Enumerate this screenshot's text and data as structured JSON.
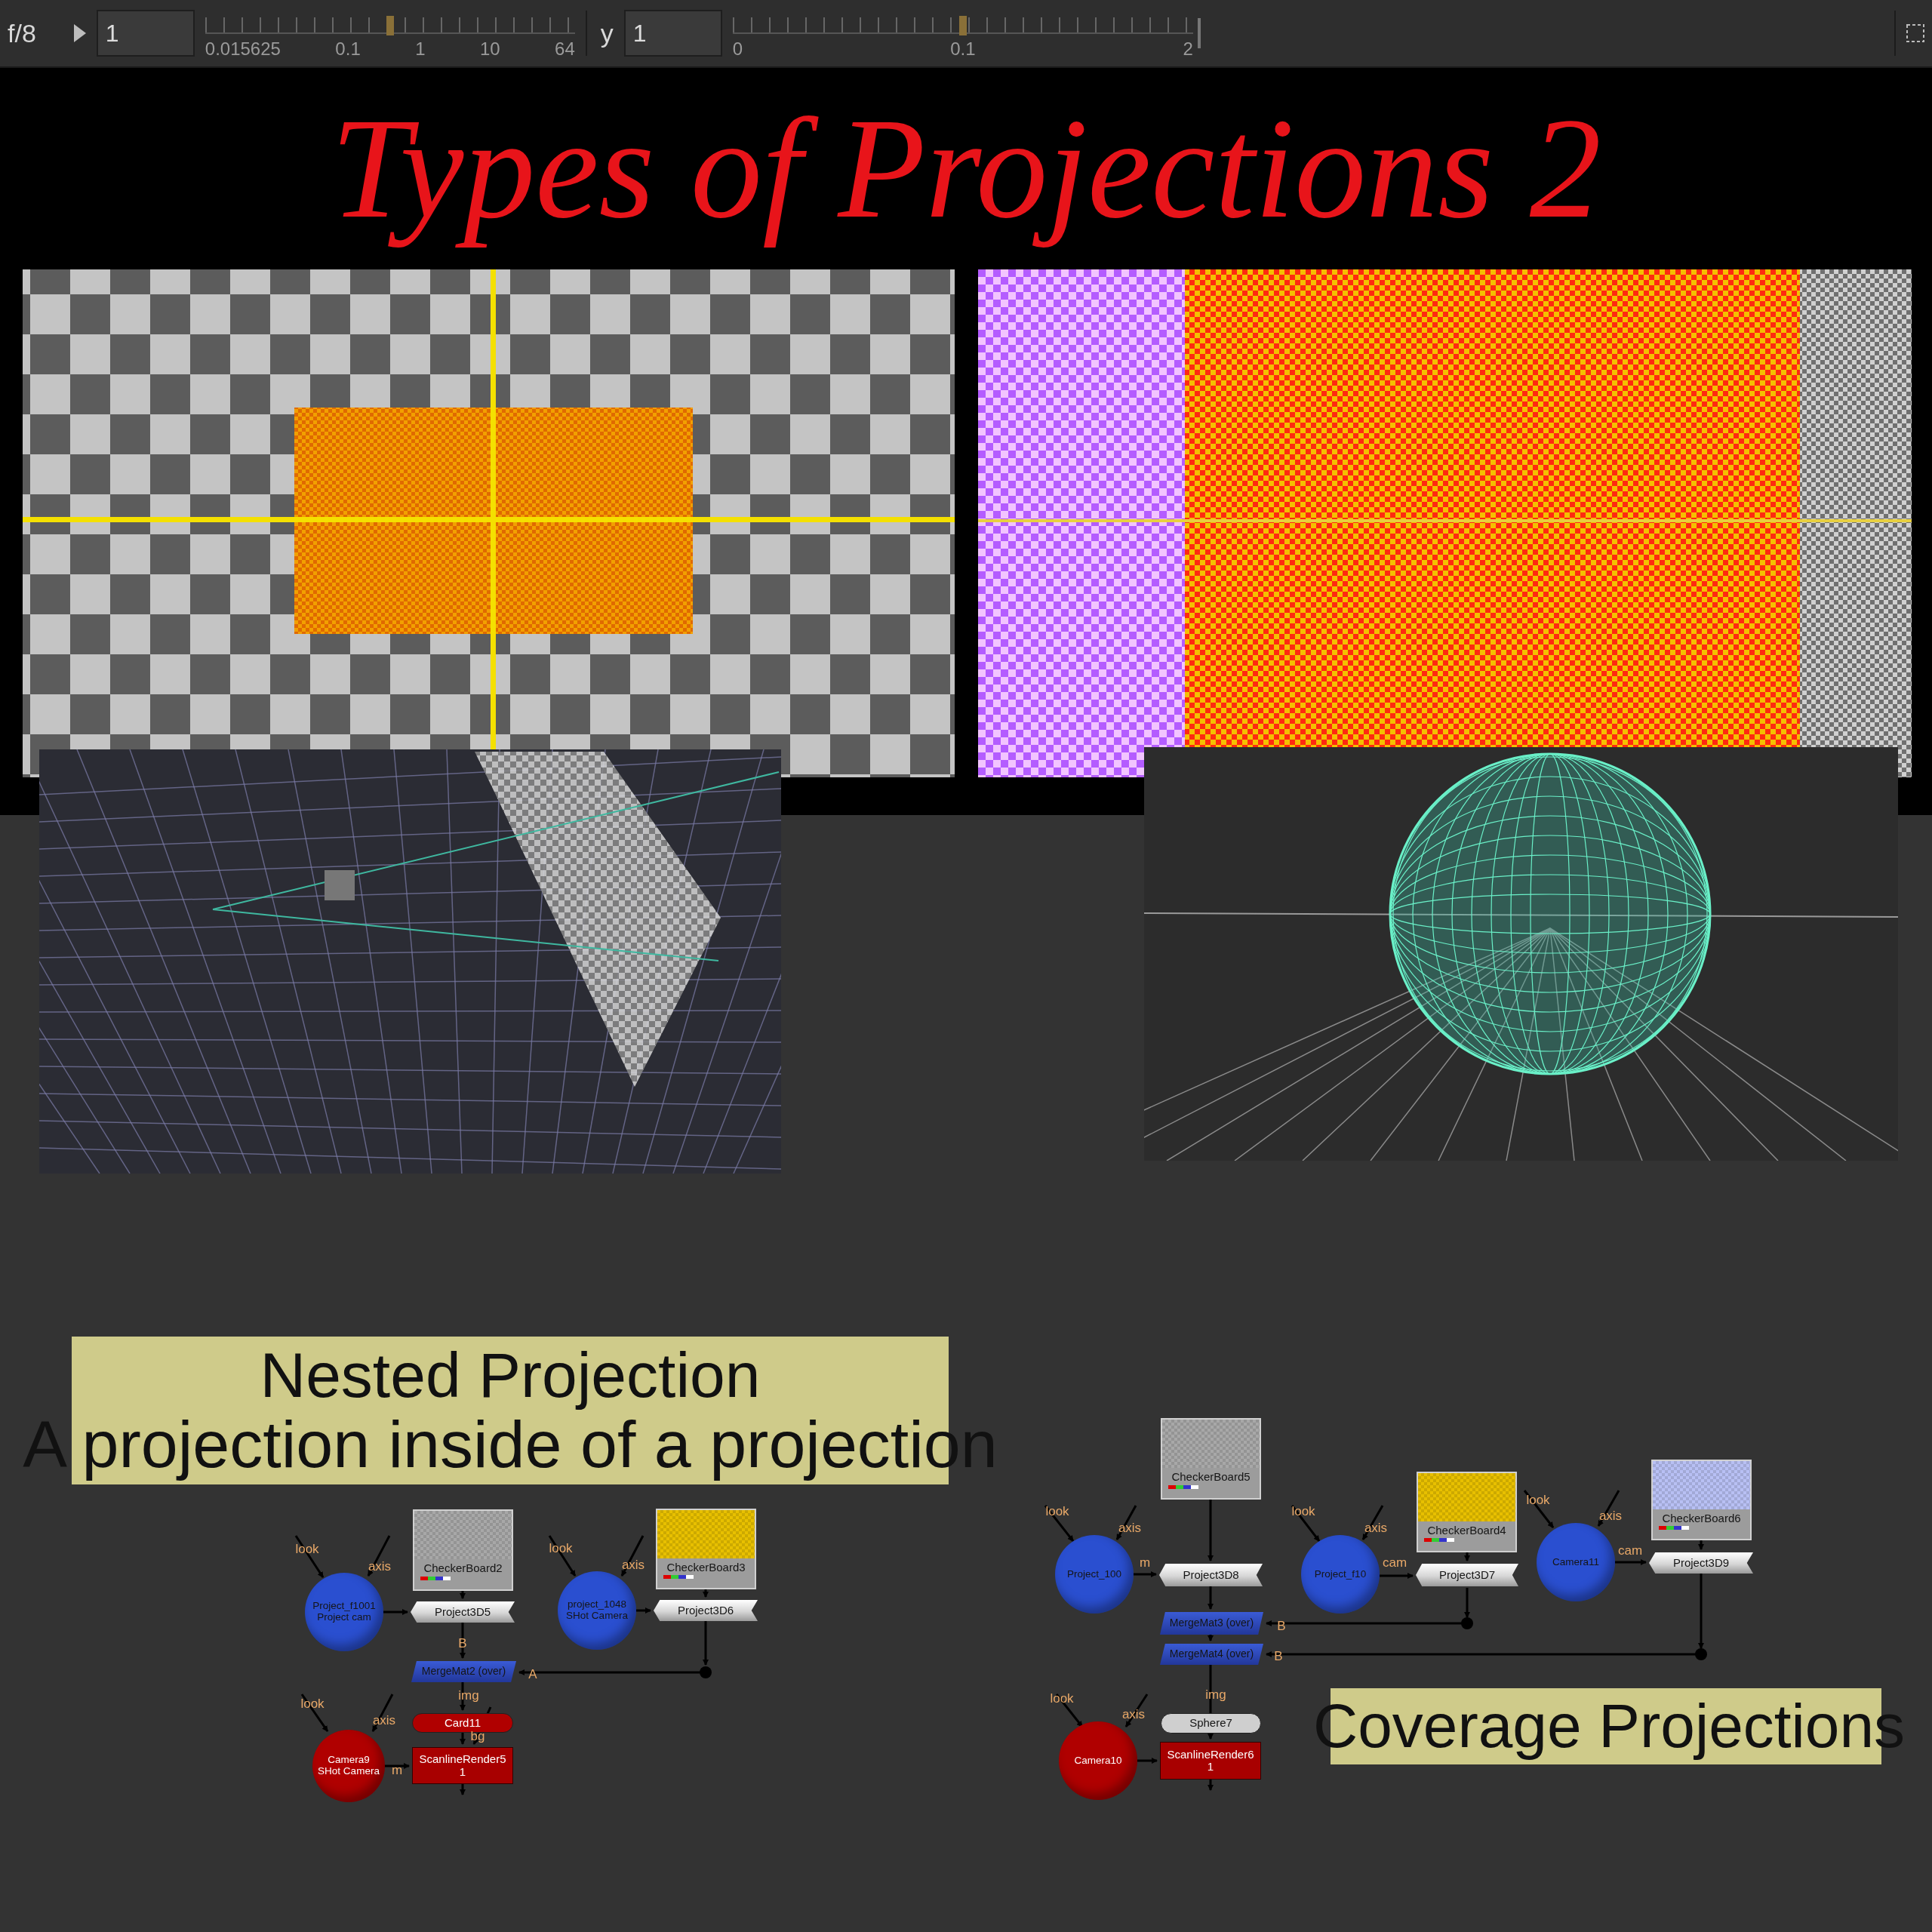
{
  "toolbar": {
    "channel": "f/8",
    "gain": {
      "value": "1",
      "level": 0.5,
      "ticks": [
        "0.015625",
        "0.1",
        "1",
        "10",
        "64"
      ]
    },
    "gamma": {
      "label": "y",
      "value": "1",
      "level": 0.5,
      "ticks": [
        "0",
        "0.1",
        "2"
      ]
    }
  },
  "title": "Types of Projections 2",
  "backdrops": [
    {
      "lines": [
        "Nested Projection",
        "A projection inside of a projection"
      ]
    },
    {
      "lines": [
        "Coverage Projections"
      ]
    }
  ],
  "graphs": [
    {
      "nodes": [
        {
          "kind": "camera",
          "label": "Project_f1001",
          "sublabel": "Project cam",
          "color": "#2a4fd0"
        },
        {
          "kind": "checkerboard",
          "label": "CheckerBoard2",
          "color": "#a8a8a8"
        },
        {
          "kind": "project3d",
          "label": "Project3D5",
          "color": "#d6d6d6"
        },
        {
          "kind": "camera",
          "label": "project_1048",
          "sublabel": "SHot Camera",
          "color": "#2a4fd0"
        },
        {
          "kind": "checkerboard",
          "label": "CheckerBoard3",
          "color": "#e8c000"
        },
        {
          "kind": "project3d",
          "label": "Project3D6",
          "color": "#d6d6d6"
        },
        {
          "kind": "mergemat",
          "label": "MergeMat2 (over)",
          "color": "#3a5bd6"
        },
        {
          "kind": "geometry",
          "label": "Card11",
          "color": "#b00000"
        },
        {
          "kind": "camera",
          "label": "Camera9",
          "sublabel": "SHot Camera",
          "color": "#b00000"
        },
        {
          "kind": "render",
          "label": "ScanlineRender5",
          "sublabel": "1",
          "color": "#a80000"
        }
      ],
      "pins": [
        "look",
        "axis",
        "look",
        "axis",
        "B",
        "A",
        "img",
        "look",
        "axis",
        "bg",
        "m"
      ]
    },
    {
      "nodes": [
        {
          "kind": "checkerboard",
          "label": "CheckerBoard5",
          "color": "#a8a8a8"
        },
        {
          "kind": "camera",
          "label": "Project_100",
          "color": "#2a4fd0"
        },
        {
          "kind": "project3d",
          "label": "Project3D8",
          "color": "#d6d6d6"
        },
        {
          "kind": "camera",
          "label": "Project_f10",
          "color": "#2a4fd0"
        },
        {
          "kind": "checkerboard",
          "label": "CheckerBoard4",
          "color": "#e8c000"
        },
        {
          "kind": "project3d",
          "label": "Project3D7",
          "color": "#d6d6d6"
        },
        {
          "kind": "camera",
          "label": "Camera11",
          "color": "#2a4fd0"
        },
        {
          "kind": "checkerboard",
          "label": "CheckerBoard6",
          "color": "#b8c0f4"
        },
        {
          "kind": "project3d",
          "label": "Project3D9",
          "color": "#d6d6d6"
        },
        {
          "kind": "mergemat",
          "label": "MergeMat3 (over)",
          "color": "#3a5bd6"
        },
        {
          "kind": "mergemat",
          "label": "MergeMat4 (over)",
          "color": "#3a5bd6"
        },
        {
          "kind": "geometry",
          "label": "Sphere7",
          "color": "#cfcfcf"
        },
        {
          "kind": "camera",
          "label": "Camera10",
          "color": "#b00000"
        },
        {
          "kind": "render",
          "label": "ScanlineRender6",
          "sublabel": "1",
          "color": "#a80000"
        }
      ],
      "pins": [
        "look",
        "axis",
        "m",
        "look",
        "axis",
        "cam",
        "look",
        "axis",
        "cam",
        "B",
        "B",
        "img",
        "look",
        "axis"
      ]
    }
  ]
}
